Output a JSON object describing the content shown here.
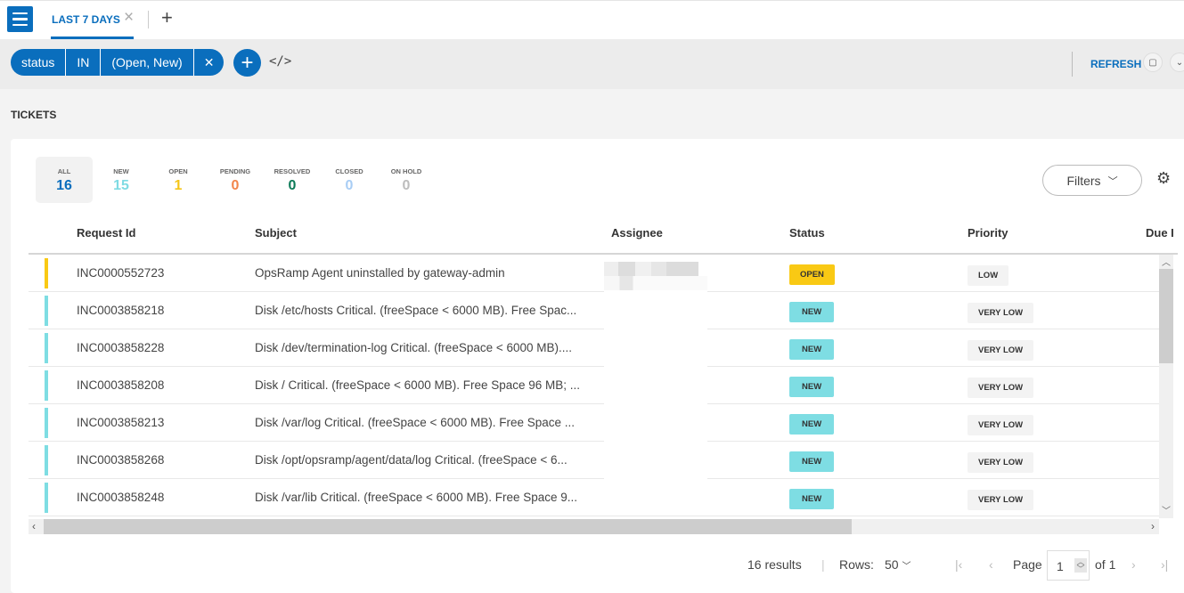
{
  "topbar": {
    "menu_icon": "hamburger-menu-icon",
    "tab_label": "LAST 7 DAYS",
    "tab_close_icon": "×",
    "add_tab_icon": "+"
  },
  "filterbar": {
    "chip": {
      "field": "status",
      "operator": "IN",
      "value": "(Open, New)",
      "remove": "✕"
    },
    "add_filter": "+",
    "code_toggle": "</>",
    "refresh_label": "REFRESH"
  },
  "section_title": "TICKETS",
  "stats": [
    {
      "label": "ALL",
      "value": "16",
      "color": "#0a6ebd"
    },
    {
      "label": "NEW",
      "value": "15",
      "color": "#7fdbe3"
    },
    {
      "label": "OPEN",
      "value": "1",
      "color": "#f5c518"
    },
    {
      "label": "PENDING",
      "value": "0",
      "color": "#f2854a"
    },
    {
      "label": "RESOLVED",
      "value": "0",
      "color": "#0b7a57"
    },
    {
      "label": "CLOSED",
      "value": "0",
      "color": "#a8cdf5"
    },
    {
      "label": "ON HOLD",
      "value": "0",
      "color": "#bdbdbd"
    }
  ],
  "filters_button": "Filters",
  "columns": [
    "Request Id",
    "Subject",
    "Assignee",
    "Status",
    "Priority",
    "Due I"
  ],
  "rows": [
    {
      "id": "INC0000552723",
      "subject": "OpsRamp Agent uninstalled by gateway-admin",
      "status": "OPEN",
      "priority": "LOW",
      "status_color": "#f9c914"
    },
    {
      "id": "INC0003858218",
      "subject": "Disk /etc/hosts Critical. (freeSpace < 6000 MB). Free Spac...",
      "status": "NEW",
      "priority": "VERY LOW",
      "status_color": "#7edde3"
    },
    {
      "id": "INC0003858228",
      "subject": "Disk /dev/termination-log Critical. (freeSpace < 6000 MB)....",
      "status": "NEW",
      "priority": "VERY LOW",
      "status_color": "#7edde3"
    },
    {
      "id": "INC0003858208",
      "subject": "Disk / Critical. (freeSpace < 6000 MB). Free Space 96 MB; ...",
      "status": "NEW",
      "priority": "VERY LOW",
      "status_color": "#7edde3"
    },
    {
      "id": "INC0003858213",
      "subject": "Disk /var/log Critical. (freeSpace < 6000 MB). Free Space ...",
      "status": "NEW",
      "priority": "VERY LOW",
      "status_color": "#7edde3"
    },
    {
      "id": "INC0003858268",
      "subject": "Disk /opt/opsramp/agent/data/log Critical. (freeSpace < 6...",
      "status": "NEW",
      "priority": "VERY LOW",
      "status_color": "#7edde3"
    },
    {
      "id": "INC0003858248",
      "subject": "Disk /var/lib Critical. (freeSpace < 6000 MB). Free Space 9...",
      "status": "NEW",
      "priority": "VERY LOW",
      "status_color": "#7edde3"
    }
  ],
  "pagination": {
    "results": "16 results",
    "rows_label": "Rows:",
    "rows_value": "50",
    "page_label": "Page",
    "page_value": "1",
    "of_label": "of 1"
  }
}
